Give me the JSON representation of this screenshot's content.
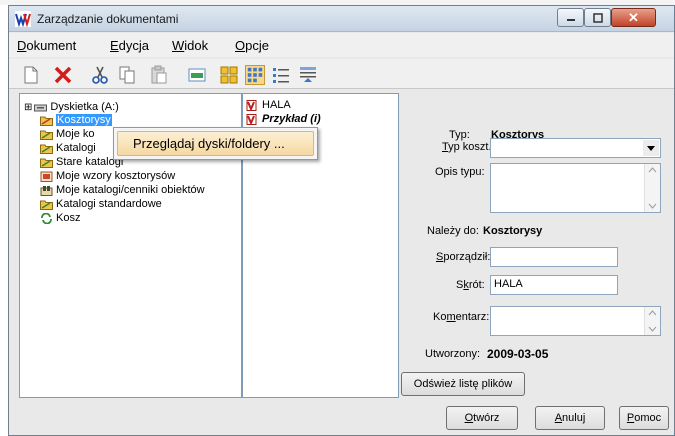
{
  "window": {
    "title": "Zarządzanie dokumentami",
    "close_glyph": "✕"
  },
  "menu": {
    "items": [
      {
        "first": "D",
        "rest": "okument"
      },
      {
        "first": "E",
        "rest": "dycja"
      },
      {
        "first": "W",
        "rest": "idok"
      },
      {
        "first": "O",
        "rest": "pcje"
      }
    ]
  },
  "toolbar": {
    "icons": [
      "new-document-icon",
      "delete-icon",
      "cut-icon",
      "copy-icon",
      "paste-icon",
      "preview-icon",
      "large-icons-view-icon",
      "small-icons-view-icon",
      "list-view-icon",
      "details-view-icon"
    ],
    "active_index": 7
  },
  "tree": {
    "items": [
      {
        "label": "Dyskietka (A:)",
        "icon": "floppy-drive-icon",
        "expander": "⊞"
      },
      {
        "label": "Kosztorysy",
        "icon": "folder-icon",
        "selected": true
      },
      {
        "label": "Moje ko",
        "icon": "folder-icon"
      },
      {
        "label": "Katalogi",
        "icon": "folder-icon"
      },
      {
        "label": "Stare katalogi",
        "icon": "folder-icon"
      },
      {
        "label": "Moje wzory kosztorysów",
        "icon": "template-folder-icon"
      },
      {
        "label": "Moje katalogi/cenniki obiektów",
        "icon": "catalog-folder-icon"
      },
      {
        "label": "Katalogi standardowe",
        "icon": "folder-icon"
      },
      {
        "label": "Kosz",
        "icon": "recycle-bin-icon"
      }
    ]
  },
  "context_menu": {
    "item": "Przeglądaj dyski/foldery ..."
  },
  "files": {
    "items": [
      {
        "label": "HALA",
        "icon": "estimate-file-icon"
      },
      {
        "label": "Przykład (i)",
        "icon": "estimate-file-icon"
      }
    ]
  },
  "properties": {
    "typ_label": "Typ:",
    "typ_value": "Kosztorys",
    "typ_koszt_label_u": "T",
    "typ_koszt_label_rest": "yp koszt.:",
    "typ_koszt_value": "",
    "opis_typu_label": "Opis typu:",
    "opis_typu_value": "",
    "nalezy_do_label": "Należy do:",
    "nalezy_do_value": "Kosztorysy",
    "sporzadzil_label_u": "S",
    "sporzadzil_label_rest": "porządził:",
    "sporzadzil_value": "",
    "skrot_label_pre": "S",
    "skrot_label_u": "k",
    "skrot_label_rest": "rót:",
    "skrot_value": "HALA",
    "komentarz_label_pre": "Ko",
    "komentarz_label_u": "m",
    "komentarz_label_rest": "entarz:",
    "komentarz_value": "",
    "utworzony_label": "Utworzony:",
    "utworzony_value": "2009-03-05",
    "refresh_button": "Odśwież listę plików"
  },
  "footer": {
    "open_u": "O",
    "open_rest": "twórz",
    "cancel_u": "A",
    "cancel_rest": "nuluj",
    "help_u": "P",
    "help_rest": "omoc"
  }
}
